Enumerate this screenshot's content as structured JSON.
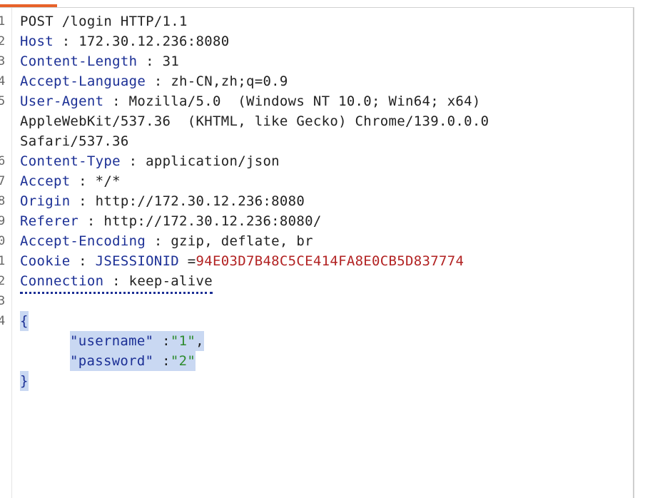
{
  "line_numbers": [
    "1",
    "2",
    "3",
    "4",
    "5",
    "",
    "",
    "6",
    "7",
    "8",
    "9",
    "0",
    "1",
    "2",
    "3",
    "4",
    "",
    "",
    ""
  ],
  "request": {
    "request_line": "POST /login HTTP/1.1",
    "headers": [
      {
        "key": "Host",
        "sep": " : ",
        "value": "172.30.12.236:8080"
      },
      {
        "key": "Content-Length",
        "sep": " : ",
        "value": "31"
      },
      {
        "key": "Accept-Language",
        "sep": " : ",
        "value": "zh-CN,zh;q=0.9"
      },
      {
        "key": "User-Agent",
        "sep": " : ",
        "value": "Mozilla/5.0  (Windows NT 10.0; Win64; x64)"
      },
      {
        "key": "Content-Type",
        "sep": " : ",
        "value": "application/json"
      },
      {
        "key": "Accept",
        "sep": " : ",
        "value": "*/*"
      },
      {
        "key": "Origin",
        "sep": " : ",
        "value": "http://172.30.12.236:8080"
      },
      {
        "key": "Referer",
        "sep": " : ",
        "value": "http://172.30.12.236:8080/"
      },
      {
        "key": "Accept-Encoding",
        "sep": " : ",
        "value": "gzip, deflate, br"
      },
      {
        "key": "Cookie",
        "sep": " : ",
        "value": ""
      },
      {
        "key": "Connection",
        "sep": " : ",
        "value": "keep-alive"
      }
    ],
    "user_agent_cont_1": "AppleWebKit/537.36  (KHTML, like Gecko) Chrome/139.0.0.0",
    "user_agent_cont_2": "Safari/537.36",
    "cookie": {
      "name": "JSESSIONID",
      "eq": " =",
      "value": "94E03D7B48C5CE414FA8E0CB5D837774"
    },
    "body": {
      "open_brace": "{",
      "close_brace": "}",
      "fields": [
        {
          "key": "\"username\"",
          "colon": " :",
          "value": "\"1\"",
          "comma": ","
        },
        {
          "key": "\"password\"",
          "colon": " :",
          "value": "\"2\"",
          "comma": ""
        }
      ]
    }
  },
  "colors": {
    "accent_tab": "#e8622a",
    "header_key": "#1b2f95",
    "cookie_value": "#b22222",
    "json_string": "#2e8b2e",
    "selection": "#c9d8f2"
  }
}
